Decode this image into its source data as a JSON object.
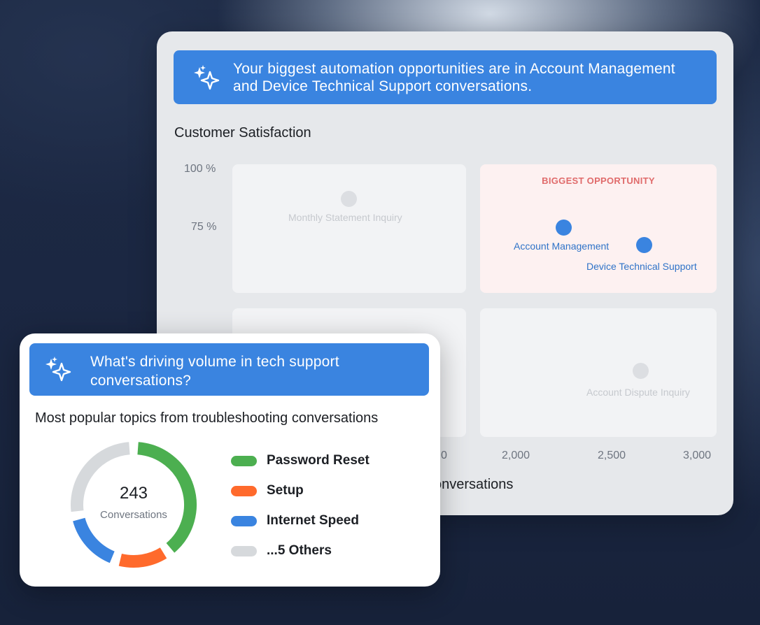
{
  "main_panel": {
    "banner_text": "Your biggest automation opportunities are in Account Management and Device Technical Support conversations.",
    "title": "Customer Satisfaction",
    "y_ticks": [
      "100 %",
      "75 %"
    ],
    "x_ticks": [
      "0",
      "2,000",
      "2,500",
      "3,000"
    ],
    "x_axis_label_visible": "onversations",
    "quadrants": [
      {
        "name": "top-left",
        "title": "",
        "highlight": false
      },
      {
        "name": "top-right",
        "title": "BIGGEST OPPORTUNITY",
        "highlight": true
      },
      {
        "name": "bottom-left",
        "title": "",
        "highlight": false
      },
      {
        "name": "bottom-right",
        "title": "",
        "highlight": false
      }
    ],
    "points": [
      {
        "label": "Monthly Statement Inquiry",
        "color": "grey"
      },
      {
        "label": "Account Management",
        "color": "blue"
      },
      {
        "label": "Device Technical Support",
        "color": "blue"
      },
      {
        "label": "Account Dispute Inquiry",
        "color": "grey"
      }
    ]
  },
  "front_panel": {
    "banner_text": "What's driving volume in tech support conversations?",
    "subtitle": "Most popular topics from troubleshooting conversations",
    "donut": {
      "value": "243",
      "caption": "Conversations"
    },
    "legend": [
      {
        "label": "Password Reset",
        "color": "#4caf50",
        "share": 0.4
      },
      {
        "label": "Setup",
        "color": "#ff6a2c",
        "share": 0.15
      },
      {
        "label": "Internet Speed",
        "color": "#3a84e0",
        "share": 0.17
      },
      {
        "label": "...5 Others",
        "color": "#d6d9dc",
        "share": 0.28
      }
    ]
  },
  "colors": {
    "accent": "#3a84e0",
    "highlight_text": "#e06b6b",
    "highlight_bg": "#fdf1f1"
  }
}
